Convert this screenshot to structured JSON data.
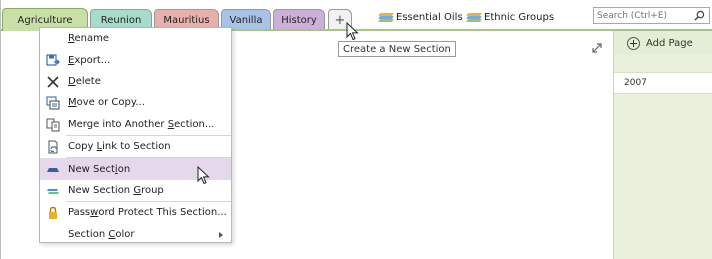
{
  "tabs": [
    {
      "label": "Agriculture",
      "color": "#c9dfa8",
      "active": true
    },
    {
      "label": "Reunion",
      "color": "#a7dccd"
    },
    {
      "label": "Mauritius",
      "color": "#e8b0ad"
    },
    {
      "label": "Vanilla",
      "color": "#a9c3e6"
    },
    {
      "label": "History",
      "color": "#cdb0d9"
    }
  ],
  "add_tab_label": "+",
  "section_groups": [
    {
      "label": "Essential Oils",
      "icon": "section-group-icon"
    },
    {
      "label": "Ethnic Groups",
      "icon": "section-group-icon"
    }
  ],
  "search": {
    "placeholder": "Search (Ctrl+E)"
  },
  "tooltip": "Create a New Section",
  "page_pane": {
    "add_page_label": "Add Page",
    "pages": [
      "2007"
    ]
  },
  "context_menu": {
    "items": [
      {
        "pre": "",
        "u": "R",
        "post": "ename",
        "icon": "none"
      },
      {
        "pre": "",
        "u": "E",
        "post": "xport...",
        "icon": "export-icon"
      },
      {
        "pre": "",
        "u": "D",
        "post": "elete",
        "icon": "delete-icon"
      },
      {
        "pre": "",
        "u": "M",
        "post": "ove or Copy...",
        "icon": "move-copy-icon"
      },
      {
        "pre": "Merge into Another ",
        "u": "S",
        "post": "ection...",
        "icon": "merge-icon"
      },
      {
        "pre": "Copy ",
        "u": "L",
        "post": "ink to Section",
        "icon": "copy-link-icon"
      },
      {
        "pre": "New Sect",
        "u": "i",
        "post": "on",
        "icon": "new-section-icon"
      },
      {
        "pre": "New Section ",
        "u": "G",
        "post": "roup",
        "icon": "new-section-group-icon"
      },
      {
        "pre": "Pass",
        "u": "w",
        "post": "ord Protect This Section...",
        "icon": "lock-icon"
      },
      {
        "pre": "Section ",
        "u": "C",
        "post": "olor",
        "icon": "none"
      }
    ]
  },
  "colors": {
    "accent_green": "#a9c584",
    "page_pane_bg": "#e9f1dd",
    "menu_highlight": "#e6d8eb"
  }
}
